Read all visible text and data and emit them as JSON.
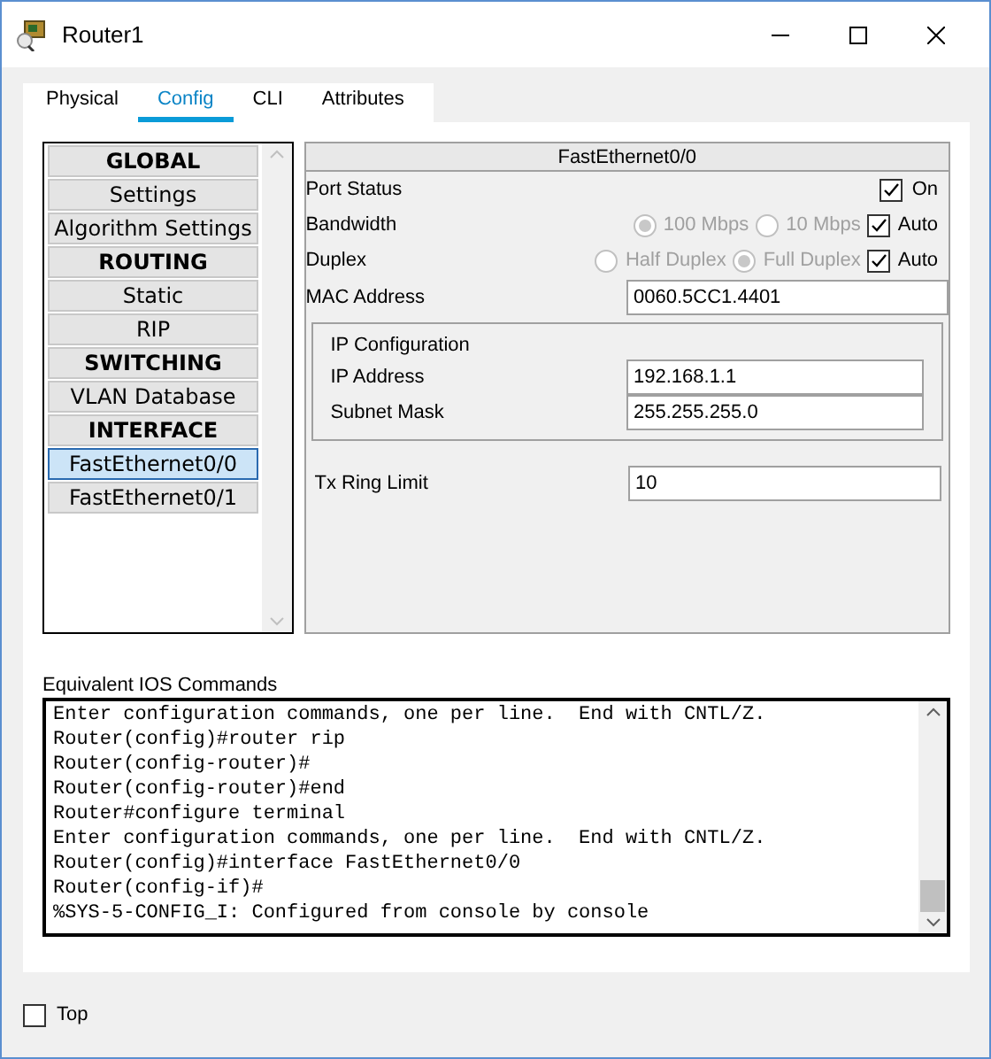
{
  "window": {
    "title": "Router1"
  },
  "tabs": [
    {
      "label": "Physical",
      "selected": false
    },
    {
      "label": "Config",
      "selected": true
    },
    {
      "label": "CLI",
      "selected": false
    },
    {
      "label": "Attributes",
      "selected": false
    }
  ],
  "sidebar": {
    "items": [
      {
        "label": "GLOBAL",
        "kind": "header",
        "selected": false
      },
      {
        "label": "Settings",
        "kind": "item",
        "selected": false
      },
      {
        "label": "Algorithm Settings",
        "kind": "item",
        "selected": false
      },
      {
        "label": "ROUTING",
        "kind": "header",
        "selected": false
      },
      {
        "label": "Static",
        "kind": "item",
        "selected": false
      },
      {
        "label": "RIP",
        "kind": "item",
        "selected": false
      },
      {
        "label": "SWITCHING",
        "kind": "header",
        "selected": false
      },
      {
        "label": "VLAN Database",
        "kind": "item",
        "selected": false
      },
      {
        "label": "INTERFACE",
        "kind": "header",
        "selected": false
      },
      {
        "label": "FastEthernet0/0",
        "kind": "item",
        "selected": true
      },
      {
        "label": "FastEthernet0/1",
        "kind": "item",
        "selected": false
      }
    ]
  },
  "interface": {
    "title": "FastEthernet0/0",
    "port_status": {
      "label": "Port Status",
      "on_label": "On",
      "checked": true
    },
    "bandwidth": {
      "label": "Bandwidth",
      "options": [
        {
          "label": "100 Mbps",
          "selected": true
        },
        {
          "label": "10 Mbps",
          "selected": false
        }
      ],
      "auto_label": "Auto",
      "auto": true
    },
    "duplex": {
      "label": "Duplex",
      "options": [
        {
          "label": "Half Duplex",
          "selected": false
        },
        {
          "label": "Full Duplex",
          "selected": true
        }
      ],
      "auto_label": "Auto",
      "auto": true
    },
    "mac": {
      "label": "MAC Address",
      "value": "0060.5CC1.4401"
    },
    "ip_config": {
      "title": "IP Configuration",
      "fields": [
        {
          "label": "IP Address",
          "value": "192.168.1.1"
        },
        {
          "label": "Subnet Mask",
          "value": "255.255.255.0"
        }
      ]
    },
    "tx_ring": {
      "label": "Tx Ring Limit",
      "value": "10"
    }
  },
  "console": {
    "label": "Equivalent IOS Commands",
    "lines": [
      "Enter configuration commands, one per line.  End with CNTL/Z.",
      "Router(config)#router rip",
      "Router(config-router)#",
      "Router(config-router)#end",
      "Router#configure terminal",
      "Enter configuration commands, one per line.  End with CNTL/Z.",
      "Router(config)#interface FastEthernet0/0",
      "Router(config-if)#",
      "%SYS-5-CONFIG_I: Configured from console by console"
    ]
  },
  "top_checkbox": {
    "label": "Top",
    "checked": false
  }
}
